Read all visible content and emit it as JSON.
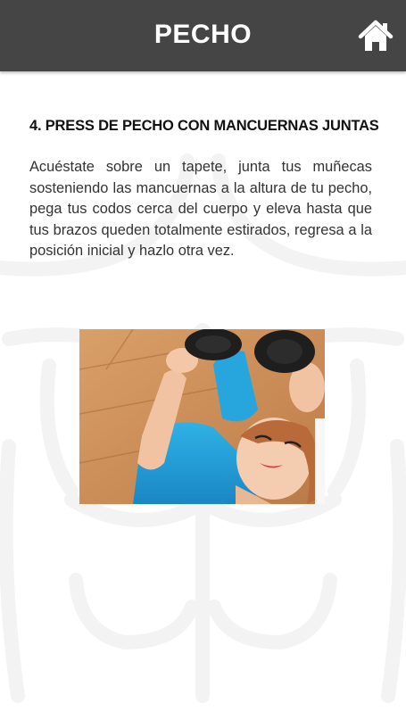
{
  "header": {
    "title": "PECHO",
    "home_icon": "home-icon"
  },
  "exercise": {
    "title": "4. PRESS DE PECHO CON MANCUERNAS JUNTAS",
    "description": "Acuéstate sobre un tapete, junta tus muñecas sosteniendo las mancuernas a la altura de tu pecho, pega tus codos cerca del cuerpo y eleva hasta que tus brazos queden totalmente estirados, regresa a la posición inicial y hazlo otra vez.",
    "image": "woman-lying-on-floor-pressing-dumbbells"
  },
  "colors": {
    "header_bg": "#454545",
    "header_text": "#ffffff",
    "title_text": "#111111",
    "body_text": "#333333",
    "watermark": "#f3f3f3"
  }
}
